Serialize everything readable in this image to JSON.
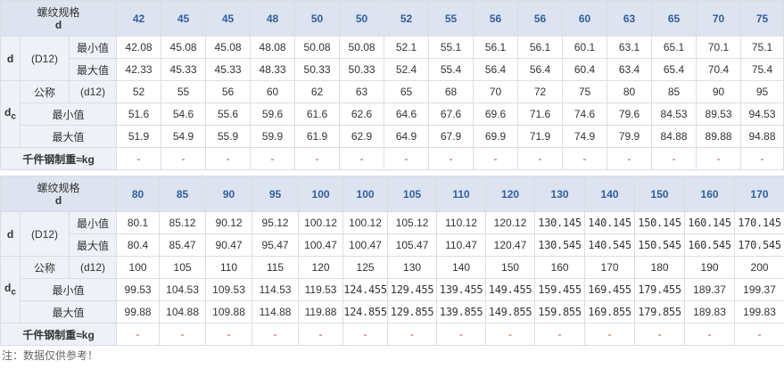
{
  "labels": {
    "header_title": "螺纹规格",
    "header_sub": "d",
    "param_d": "d",
    "param_dc_main": "d",
    "param_dc_sub": "c",
    "tol_D12": "(D12)",
    "tol_d12": "(d12)",
    "min": "最小值",
    "max": "最大值",
    "nominal": "公称",
    "weight": "千件钢制重≈kg"
  },
  "tables": [
    {
      "sizes": [
        "42",
        "45",
        "45",
        "48",
        "50",
        "50",
        "52",
        "55",
        "56",
        "56",
        "60",
        "63",
        "65",
        "70",
        "75"
      ],
      "d_min": [
        "42.08",
        "45.08",
        "45.08",
        "48.08",
        "50.08",
        "50.08",
        "52.1",
        "55.1",
        "56.1",
        "56.1",
        "60.1",
        "63.1",
        "65.1",
        "70.1",
        "75.1"
      ],
      "d_max": [
        "42.33",
        "45.33",
        "45.33",
        "48.33",
        "50.33",
        "50.33",
        "52.4",
        "55.4",
        "56.4",
        "56.4",
        "60.4",
        "63.4",
        "65.4",
        "70.4",
        "75.4"
      ],
      "dc_nom": [
        "52",
        "55",
        "56",
        "60",
        "62",
        "63",
        "65",
        "68",
        "70",
        "72",
        "75",
        "80",
        "85",
        "90",
        "95"
      ],
      "dc_min": [
        "51.6",
        "54.6",
        "55.6",
        "59.6",
        "61.6",
        "62.6",
        "64.6",
        "67.6",
        "69.6",
        "71.6",
        "74.6",
        "79.6",
        "84.53",
        "89.53",
        "94.53"
      ],
      "dc_max": [
        "51.9",
        "54.9",
        "55.9",
        "59.9",
        "61.9",
        "62.9",
        "64.9",
        "67.9",
        "69.9",
        "71.9",
        "74.9",
        "79.9",
        "84.88",
        "89.88",
        "94.88"
      ],
      "weight": [
        "-",
        "-",
        "-",
        "-",
        "-",
        "-",
        "-",
        "-",
        "-",
        "-",
        "-",
        "-",
        "-",
        "-",
        "-"
      ]
    },
    {
      "sizes": [
        "80",
        "85",
        "90",
        "95",
        "100",
        "100",
        "105",
        "110",
        "120",
        "130",
        "140",
        "150",
        "160",
        "170"
      ],
      "d_min": [
        "80.1",
        "85.12",
        "90.12",
        "95.12",
        "100.12",
        "100.12",
        "105.12",
        "110.12",
        "120.12",
        "130.145",
        "140.145",
        "150.145",
        "160.145",
        "170.145"
      ],
      "d_max": [
        "80.4",
        "85.47",
        "90.47",
        "95.47",
        "100.47",
        "100.47",
        "105.47",
        "110.47",
        "120.47",
        "130.545",
        "140.545",
        "150.545",
        "160.545",
        "170.545"
      ],
      "dc_nom": [
        "100",
        "105",
        "110",
        "115",
        "120",
        "125",
        "130",
        "140",
        "150",
        "160",
        "170",
        "180",
        "190",
        "200"
      ],
      "dc_min": [
        "99.53",
        "104.53",
        "109.53",
        "114.53",
        "119.53",
        "124.455",
        "129.455",
        "139.455",
        "149.455",
        "159.455",
        "169.455",
        "179.455",
        "189.37",
        "199.37"
      ],
      "dc_max": [
        "99.88",
        "104.88",
        "109.88",
        "114.88",
        "119.88",
        "124.855",
        "129.855",
        "139.855",
        "149.855",
        "159.855",
        "169.855",
        "179.855",
        "189.83",
        "199.83"
      ],
      "weight": [
        "-",
        "-",
        "-",
        "-",
        "-",
        "-",
        "-",
        "-",
        "-",
        "-",
        "-",
        "-",
        "-",
        "-"
      ]
    }
  ],
  "note": "注：数据仅供参考！"
}
